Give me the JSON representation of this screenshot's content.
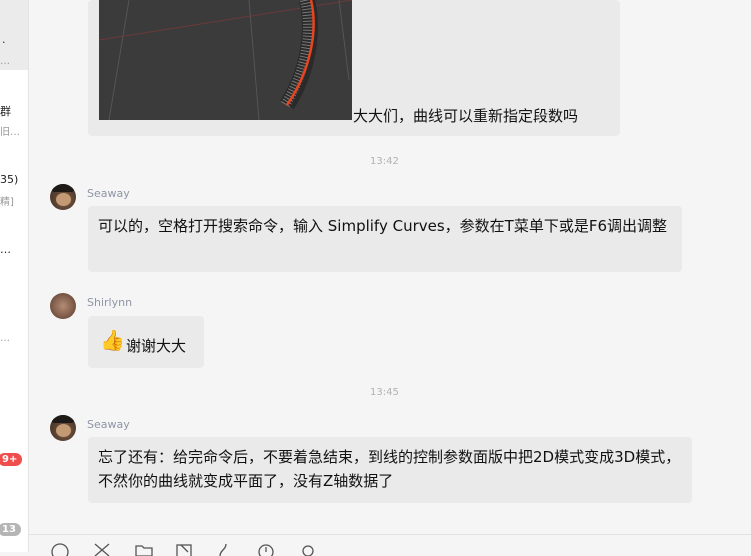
{
  "conversation_list": [
    {
      "line1": "·",
      "line2": "…",
      "active": true
    },
    {
      "line1": "群",
      "line2": "旧…",
      "active": false
    },
    {
      "line1": "35)",
      "line2": "精]",
      "active": false
    },
    {
      "line1": "…",
      "line2": "",
      "active": false
    },
    {
      "line1": "",
      "line2": "…",
      "active": false
    }
  ],
  "badges": {
    "unread_1": "9+",
    "unread_2": "13"
  },
  "messages": {
    "msg0": {
      "text": "大大们，曲线可以重新指定段数吗"
    },
    "time1": "13:42",
    "msg1": {
      "sender": "Seaway",
      "text": "可以的，空格打开搜索命令，输入 Simplify Curves，参数在T菜单下或是F6调出调整"
    },
    "msg2": {
      "sender": "Shirlynn",
      "emoji": "👍",
      "text": "谢谢大大"
    },
    "time2": "13:45",
    "msg3": {
      "sender": "Seaway",
      "text": "忘了还有：给完命令后，不要着急结束，到线的控制参数面版中把2D模式变成3D模式，不然你的曲线就变成平面了，没有Z轴数据了"
    }
  },
  "toolbar_icons": [
    "emoji-icon",
    "scissors-icon",
    "folder-icon",
    "screenshot-icon",
    "voice-icon",
    "history-icon",
    "search-icon"
  ],
  "colors": {
    "bubble": "#eaeaea",
    "badge_red": "#f04d4d",
    "sender": "#8e95a6"
  }
}
